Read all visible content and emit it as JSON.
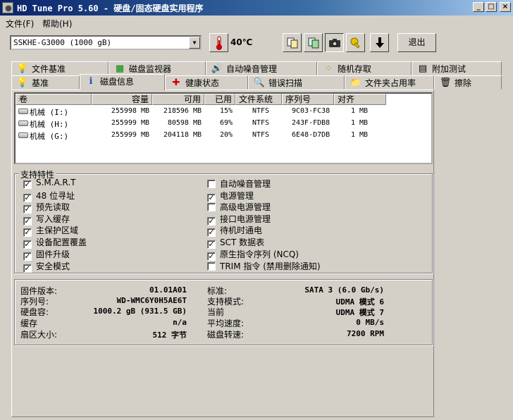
{
  "window": {
    "title": "HD Tune Pro 5.60 - 硬盘/固态硬盘实用程序",
    "minimize": "_",
    "maximize": "□",
    "close": "×"
  },
  "menu": [
    "文件(F)",
    "帮助(H)"
  ],
  "toolbar": {
    "drive": "SSKHE-G3000 (1000 gB)",
    "temperature": "40℃",
    "exit_label": "退出"
  },
  "tabs_row1": [
    {
      "label": "文件基准",
      "icon": "bulb-icon",
      "glyph": "💡"
    },
    {
      "label": "磁盘监视器",
      "icon": "chart-icon",
      "glyph": "▦"
    },
    {
      "label": "自动噪音管理",
      "icon": "speaker-icon",
      "glyph": "🔊"
    },
    {
      "label": "随机存取",
      "icon": "dice-icon",
      "glyph": "⁘"
    },
    {
      "label": "附加测试",
      "icon": "grid-icon",
      "glyph": "▤"
    }
  ],
  "tabs_row2": [
    {
      "label": "基准",
      "icon": "bulb-icon",
      "glyph": "💡"
    },
    {
      "label": "磁盘信息",
      "icon": "info-icon",
      "glyph": "ℹ"
    },
    {
      "label": "健康状态",
      "icon": "cross-icon",
      "glyph": "✚"
    },
    {
      "label": "错误扫描",
      "icon": "magnifier-icon",
      "glyph": "🔍"
    },
    {
      "label": "文件夹占用率",
      "icon": "folder-icon",
      "glyph": "📁"
    },
    {
      "label": "擦除",
      "icon": "trash-icon",
      "glyph": "🗑"
    }
  ],
  "partitions": {
    "columns": [
      "卷",
      "容量",
      "可用",
      "已用",
      "文件系统",
      "序列号",
      "对齐"
    ],
    "rows": [
      [
        "机械 (I:)",
        "255998 MB",
        "218596 MB",
        "15%",
        "NTFS",
        "9C03-FC38",
        "1 MB"
      ],
      [
        "机械 (H:)",
        "255999 MB",
        "80598 MB",
        "69%",
        "NTFS",
        "243F-FDB8",
        "1 MB"
      ],
      [
        "机械 (G:)",
        "255999 MB",
        "204118 MB",
        "20%",
        "NTFS",
        "6E48-D7DB",
        "1 MB"
      ]
    ]
  },
  "features": {
    "title": "支持特性",
    "left": [
      {
        "label": "S.M.A.R.T",
        "checked": true
      },
      {
        "label": "48 位寻址",
        "checked": true
      },
      {
        "label": "预先读取",
        "checked": true
      },
      {
        "label": "写入缓存",
        "checked": true
      },
      {
        "label": "主保护区域",
        "checked": true
      },
      {
        "label": "设备配置覆盖",
        "checked": true
      },
      {
        "label": "固件升级",
        "checked": true
      },
      {
        "label": "安全模式",
        "checked": true
      }
    ],
    "right": [
      {
        "label": "自动噪音管理",
        "checked": false
      },
      {
        "label": "电源管理",
        "checked": true
      },
      {
        "label": "高级电源管理",
        "checked": false
      },
      {
        "label": "接口电源管理",
        "checked": true
      },
      {
        "label": "待机时通电",
        "checked": true
      },
      {
        "label": "SCT 数据表",
        "checked": true
      },
      {
        "label": "原生指令序列 (NCQ)",
        "checked": true
      },
      {
        "label": "TRIM 指令 (禁用删除通知)",
        "checked": false
      }
    ]
  },
  "info": {
    "left": [
      {
        "label": "固件版本:",
        "value": "01.01A01"
      },
      {
        "label": "序列号:",
        "value": "WD-WMC6Y0H5AE6T"
      },
      {
        "label": "硬盘容:",
        "value": "1000.2 gB (931.5 GB)"
      },
      {
        "label": "缓存",
        "value": "n/a"
      },
      {
        "label": "扇区大小:",
        "value": "512 字节"
      }
    ],
    "right": [
      {
        "label": "标准:",
        "value": "SATA 3 (6.0 Gb/s)"
      },
      {
        "label": "支持模式:",
        "value": "UDMA 模式 6"
      },
      {
        "label": "当前",
        "value": "UDMA 模式 7"
      },
      {
        "label": "平均速度:",
        "value": "0 MB/s"
      },
      {
        "label": "磁盘转速:",
        "value": "7200 RPM"
      }
    ]
  }
}
